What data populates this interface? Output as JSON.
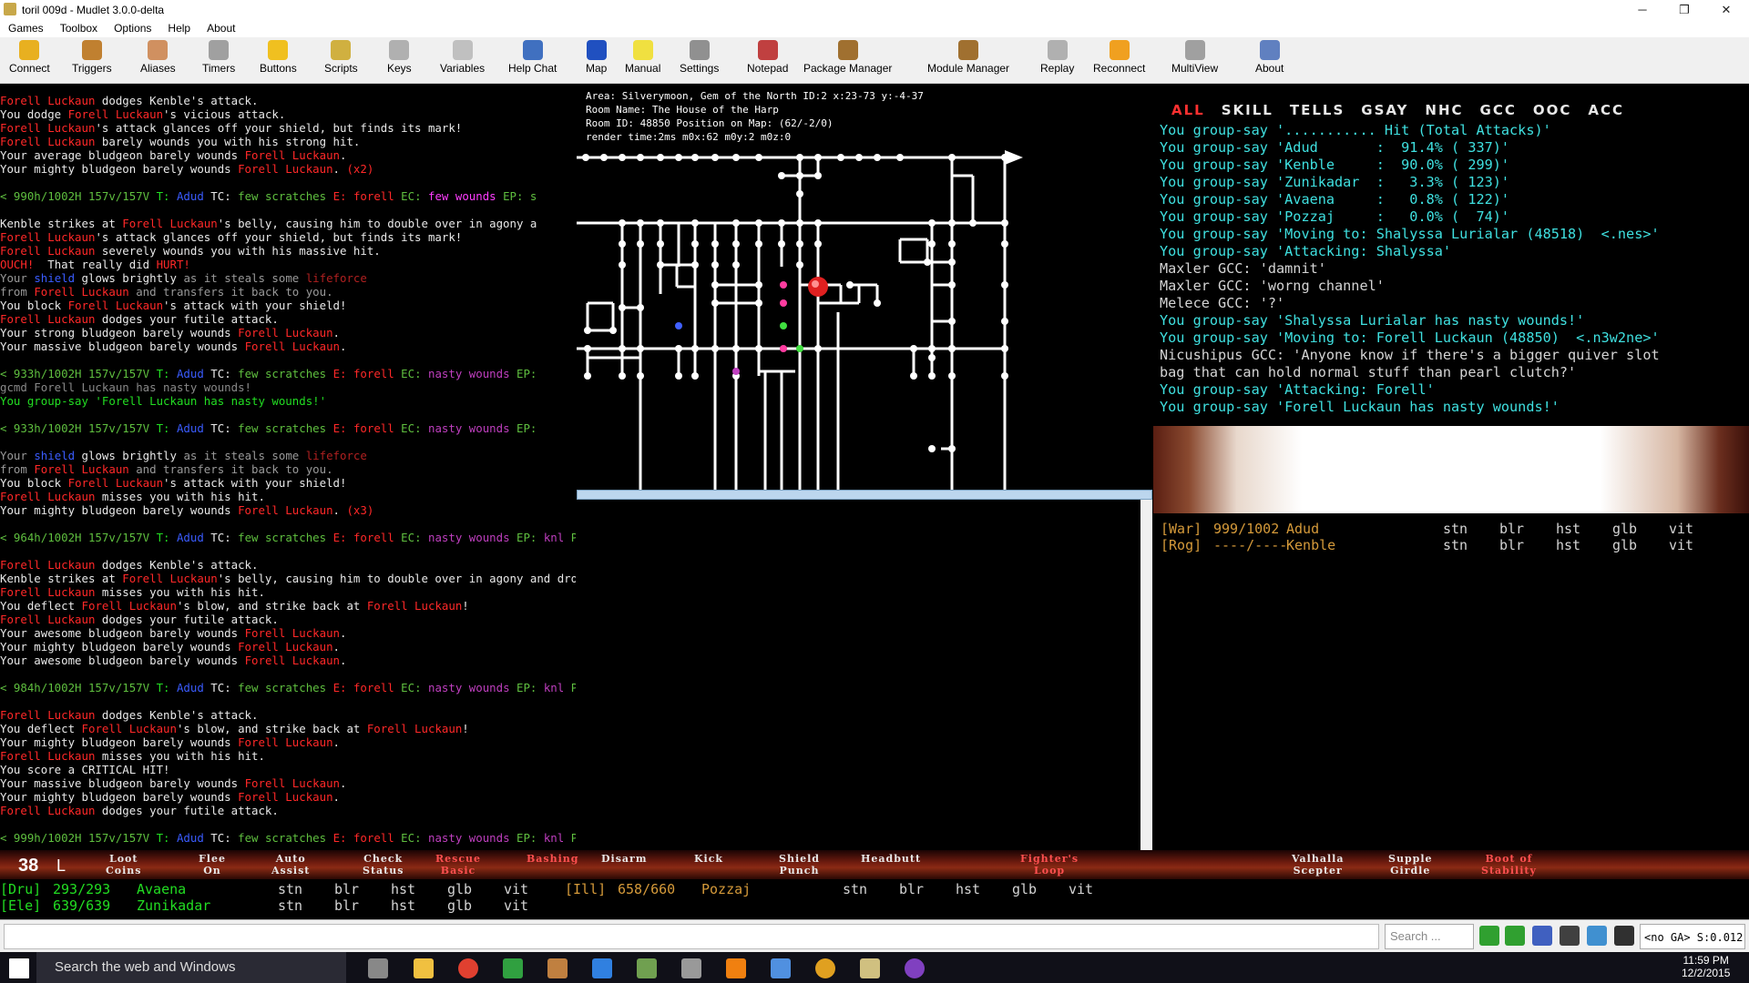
{
  "window": {
    "title": "toril 009d - Mudlet 3.0.0-delta",
    "min": "─",
    "max": "❐",
    "close": "✕"
  },
  "menu": [
    "Games",
    "Toolbox",
    "Options",
    "Help",
    "About"
  ],
  "toolbar": [
    {
      "label": "Connect",
      "icon": "connect-icon",
      "color": "#e8b020"
    },
    {
      "label": "Triggers",
      "icon": "triggers-icon",
      "color": "#c08030"
    },
    {
      "label": "Aliases",
      "icon": "aliases-icon",
      "color": "#d09060"
    },
    {
      "label": "Timers",
      "icon": "timers-icon",
      "color": "#a0a0a0"
    },
    {
      "label": "Buttons",
      "icon": "buttons-icon",
      "color": "#f0c020"
    },
    {
      "label": "Scripts",
      "icon": "scripts-icon",
      "color": "#d0b040"
    },
    {
      "label": "Keys",
      "icon": "keys-icon",
      "color": "#b0b0b0"
    },
    {
      "label": "Variables",
      "icon": "variables-icon",
      "color": "#c0c0c0"
    },
    {
      "label": "Help Chat",
      "icon": "help-chat-icon",
      "color": "#4070c0"
    },
    {
      "label": "Map",
      "icon": "map-icon",
      "color": "#2050c0"
    },
    {
      "label": "Manual",
      "icon": "manual-icon",
      "color": "#f0e040"
    },
    {
      "label": "Settings",
      "icon": "settings-icon",
      "color": "#909090"
    },
    {
      "label": "Notepad",
      "icon": "notepad-icon",
      "color": "#c04040"
    },
    {
      "label": "Package Manager",
      "icon": "package-manager-icon",
      "color": "#a07030"
    },
    {
      "label": "Module Manager",
      "icon": "module-manager-icon",
      "color": "#a07030"
    },
    {
      "label": "Replay",
      "icon": "replay-icon",
      "color": "#b0b0b0"
    },
    {
      "label": "Reconnect",
      "icon": "reconnect-icon",
      "color": "#f0a020"
    },
    {
      "label": "MultiView",
      "icon": "multiview-icon",
      "color": "#a0a0a0"
    },
    {
      "label": "About",
      "icon": "about-icon",
      "color": "#6080c0"
    }
  ],
  "main_output": [
    [
      [
        "r",
        "Forell Luckaun"
      ],
      [
        "w",
        " dodges Kenble's attack."
      ]
    ],
    [
      [
        "w",
        "You dodge "
      ],
      [
        "r",
        "Forell Luckaun"
      ],
      [
        "w",
        "'s vicious attack."
      ]
    ],
    [
      [
        "r",
        "Forell Luckaun"
      ],
      [
        "w",
        "'s attack glances off your shield, but finds its mark!"
      ]
    ],
    [
      [
        "r",
        "Forell Luckaun"
      ],
      [
        "w",
        " barely wounds you with his strong hit."
      ]
    ],
    [
      [
        "w",
        "Your average bludgeon barely wounds "
      ],
      [
        "r",
        "Forell Luckaun"
      ],
      [
        "w",
        "."
      ]
    ],
    [
      [
        "w",
        "Your mighty bludgeon barely wounds "
      ],
      [
        "r",
        "Forell Luckaun"
      ],
      [
        "w",
        ". "
      ],
      [
        "r",
        "(x2)"
      ]
    ],
    [
      [
        "w",
        ""
      ]
    ],
    [
      [
        "g",
        "< 990h/1002H 157v/157V "
      ],
      [
        "lg",
        "T: "
      ],
      [
        "b",
        "Adud "
      ],
      [
        "w",
        "TC: "
      ],
      [
        "g",
        "few scratches "
      ],
      [
        "r",
        "E: forell "
      ],
      [
        "g",
        "EC: "
      ],
      [
        "mb",
        "few wounds "
      ],
      [
        "g",
        "EP: s"
      ]
    ],
    [
      [
        "w",
        ""
      ]
    ],
    [
      [
        "w",
        "Kenble "
      ],
      [
        "w",
        "strikes at "
      ],
      [
        "r",
        "Forell Luckaun"
      ],
      [
        "w",
        "'s belly, causing him to double over in agony a"
      ]
    ],
    [
      [
        "r",
        "Forell Luckaun"
      ],
      [
        "w",
        "'s attack glances off your shield, but finds its mark!"
      ]
    ],
    [
      [
        "r",
        "Forell Luckaun"
      ],
      [
        "w",
        " severely wounds you with his massive hit."
      ]
    ],
    [
      [
        "r",
        "OUCH!"
      ],
      [
        "w",
        "  That really did "
      ],
      [
        "r",
        "HURT!"
      ]
    ],
    [
      [
        "gy",
        "Your "
      ],
      [
        "b",
        "shield"
      ],
      [
        "w",
        " glows brightly "
      ],
      [
        "gy",
        "as it steals some "
      ],
      [
        "dr",
        "lifeforce"
      ]
    ],
    [
      [
        "gy",
        "from "
      ],
      [
        "r",
        "Forell Luckaun"
      ],
      [
        "gy",
        " and transfers it back to you."
      ]
    ],
    [
      [
        "w",
        "You block "
      ],
      [
        "r",
        "Forell Luckaun"
      ],
      [
        "w",
        "'s attack with your shield!"
      ]
    ],
    [
      [
        "r",
        "Forell Luckaun"
      ],
      [
        "w",
        " dodges your futile attack."
      ]
    ],
    [
      [
        "w",
        "Your strong bludgeon barely wounds "
      ],
      [
        "r",
        "Forell Luckaun"
      ],
      [
        "w",
        "."
      ]
    ],
    [
      [
        "w",
        "Your massive bludgeon barely wounds "
      ],
      [
        "r",
        "Forell Luckaun"
      ],
      [
        "w",
        "."
      ]
    ],
    [
      [
        "w",
        ""
      ]
    ],
    [
      [
        "g",
        "< 933h/1002H 157v/157V "
      ],
      [
        "lg",
        "T: "
      ],
      [
        "b",
        "Adud "
      ],
      [
        "w",
        "TC: "
      ],
      [
        "g",
        "few scratches "
      ],
      [
        "r",
        "E: forell "
      ],
      [
        "g",
        "EC: "
      ],
      [
        "m",
        "nasty wounds "
      ],
      [
        "g",
        "EP:"
      ]
    ],
    [
      [
        "dg",
        "gcmd Forell Luckaun has nasty wounds!"
      ]
    ],
    [
      [
        "lg",
        "You group-say 'Forell Luckaun has nasty wounds!'"
      ]
    ],
    [
      [
        "w",
        ""
      ]
    ],
    [
      [
        "g",
        "< 933h/1002H 157v/157V "
      ],
      [
        "lg",
        "T: "
      ],
      [
        "b",
        "Adud "
      ],
      [
        "w",
        "TC: "
      ],
      [
        "g",
        "few scratches "
      ],
      [
        "r",
        "E: forell "
      ],
      [
        "g",
        "EC: "
      ],
      [
        "m",
        "nasty wounds "
      ],
      [
        "g",
        "EP:"
      ]
    ],
    [
      [
        "w",
        ""
      ]
    ],
    [
      [
        "gy",
        "Your "
      ],
      [
        "b",
        "shield"
      ],
      [
        "w",
        " glows brightly "
      ],
      [
        "gy",
        "as it steals some "
      ],
      [
        "dr",
        "lifeforce"
      ]
    ],
    [
      [
        "gy",
        "from "
      ],
      [
        "r",
        "Forell Luckaun"
      ],
      [
        "gy",
        " and transfers it back to you."
      ]
    ],
    [
      [
        "w",
        "You block "
      ],
      [
        "r",
        "Forell Luckaun"
      ],
      [
        "w",
        "'s attack with your shield!"
      ]
    ],
    [
      [
        "r",
        "Forell Luckaun"
      ],
      [
        "w",
        " misses you with his hit."
      ]
    ],
    [
      [
        "w",
        "Your mighty bludgeon barely wounds "
      ],
      [
        "r",
        "Forell Luckaun"
      ],
      [
        "w",
        ". "
      ],
      [
        "r",
        "(x3)"
      ]
    ],
    [
      [
        "w",
        ""
      ]
    ],
    [
      [
        "g",
        "< 964h/1002H 157v/157V "
      ],
      [
        "lg",
        "T: "
      ],
      [
        "b",
        "Adud "
      ],
      [
        "w",
        "TC: "
      ],
      [
        "g",
        "few scratches "
      ],
      [
        "r",
        "E: forell "
      ],
      [
        "g",
        "EC: "
      ],
      [
        "m",
        "nasty wounds "
      ],
      [
        "g",
        "EP: "
      ],
      [
        "m",
        "knl "
      ],
      [
        "g",
        "P: "
      ],
      [
        "w",
        "std >"
      ]
    ],
    [
      [
        "w",
        ""
      ]
    ],
    [
      [
        "r",
        "Forell Luckaun"
      ],
      [
        "w",
        " dodges Kenble's attack."
      ]
    ],
    [
      [
        "w",
        "Kenble strikes at "
      ],
      [
        "r",
        "Forell Luckaun"
      ],
      [
        "w",
        "'s belly, causing him to double over in agony and drop to his knees!"
      ]
    ],
    [
      [
        "r",
        "Forell Luckaun"
      ],
      [
        "w",
        " misses you with his hit."
      ]
    ],
    [
      [
        "w",
        "You deflect "
      ],
      [
        "r",
        "Forell Luckaun"
      ],
      [
        "w",
        "'s blow, and strike back at "
      ],
      [
        "r",
        "Forell Luckaun"
      ],
      [
        "w",
        "!"
      ]
    ],
    [
      [
        "r",
        "Forell Luckaun"
      ],
      [
        "w",
        " dodges your futile attack."
      ]
    ],
    [
      [
        "w",
        "Your awesome bludgeon barely wounds "
      ],
      [
        "r",
        "Forell Luckaun"
      ],
      [
        "w",
        "."
      ]
    ],
    [
      [
        "w",
        "Your mighty bludgeon barely wounds "
      ],
      [
        "r",
        "Forell Luckaun"
      ],
      [
        "w",
        "."
      ]
    ],
    [
      [
        "w",
        "Your awesome bludgeon barely wounds "
      ],
      [
        "r",
        "Forell Luckaun"
      ],
      [
        "w",
        "."
      ]
    ],
    [
      [
        "w",
        ""
      ]
    ],
    [
      [
        "g",
        "< 984h/1002H 157v/157V "
      ],
      [
        "lg",
        "T: "
      ],
      [
        "b",
        "Adud "
      ],
      [
        "w",
        "TC: "
      ],
      [
        "g",
        "few scratches "
      ],
      [
        "r",
        "E: forell "
      ],
      [
        "g",
        "EC: "
      ],
      [
        "m",
        "nasty wounds "
      ],
      [
        "g",
        "EP: "
      ],
      [
        "m",
        "knl "
      ],
      [
        "g",
        "P: "
      ],
      [
        "w",
        "std >"
      ]
    ],
    [
      [
        "w",
        ""
      ]
    ],
    [
      [
        "r",
        "Forell Luckaun"
      ],
      [
        "w",
        " dodges Kenble's attack."
      ]
    ],
    [
      [
        "w",
        "You deflect "
      ],
      [
        "r",
        "Forell Luckaun"
      ],
      [
        "w",
        "'s blow, and strike back at "
      ],
      [
        "r",
        "Forell Luckaun"
      ],
      [
        "w",
        "!"
      ]
    ],
    [
      [
        "w",
        "Your mighty bludgeon barely wounds "
      ],
      [
        "r",
        "Forell Luckaun"
      ],
      [
        "w",
        "."
      ]
    ],
    [
      [
        "r",
        "Forell Luckaun"
      ],
      [
        "w",
        " misses you with his hit."
      ]
    ],
    [
      [
        "w",
        "You score a CRITICAL HIT!"
      ]
    ],
    [
      [
        "w",
        "Your massive bludgeon barely wounds "
      ],
      [
        "r",
        "Forell Luckaun"
      ],
      [
        "w",
        "."
      ]
    ],
    [
      [
        "w",
        "Your mighty bludgeon barely wounds "
      ],
      [
        "r",
        "Forell Luckaun"
      ],
      [
        "w",
        "."
      ]
    ],
    [
      [
        "r",
        "Forell Luckaun"
      ],
      [
        "w",
        " dodges your futile attack."
      ]
    ],
    [
      [
        "w",
        ""
      ]
    ],
    [
      [
        "g",
        "< 999h/1002H 157v/157V "
      ],
      [
        "lg",
        "T: "
      ],
      [
        "b",
        "Adud "
      ],
      [
        "w",
        "TC: "
      ],
      [
        "g",
        "few scratches "
      ],
      [
        "r",
        "E: forell "
      ],
      [
        "g",
        "EC: "
      ],
      [
        "m",
        "nasty wounds "
      ],
      [
        "g",
        "EP: "
      ],
      [
        "m",
        "knl "
      ],
      [
        "g",
        "P: "
      ],
      [
        "w",
        "std >"
      ]
    ]
  ],
  "map_info": [
    "Area: Silverymoon, Gem of the North ID:2 x:23-73 y:-4-37",
    "Room Name: The House of the Harp",
    "Room ID: 48850 Position on Map: (62/-2/0)",
    "render time:2ms m0x:62 m0y:2 m0z:0"
  ],
  "chat_tabs": [
    "ALL",
    "SKILL",
    "TELLS",
    "GSAY",
    "NHC",
    "GCC",
    "OOC",
    "ACC"
  ],
  "chat_lines": [
    [
      [
        "cy",
        "You group-say '........... Hit (Total Attacks)'"
      ]
    ],
    [
      [
        "cy",
        "You group-say 'Adud       :  91.4% ( 337)'"
      ]
    ],
    [
      [
        "cy",
        "You group-say 'Kenble     :  90.0% ( 299)'"
      ]
    ],
    [
      [
        "cy",
        "You group-say 'Zunikadar  :   3.3% ( 123)'"
      ]
    ],
    [
      [
        "cy",
        "You group-say 'Avaena     :   0.8% ( 122)'"
      ]
    ],
    [
      [
        "cy",
        "You group-say 'Pozzaj     :   0.0% (  74)'"
      ]
    ],
    [
      [
        "cy",
        "You group-say 'Moving to: Shalyssa Lurialar (48518)  <.nes>'"
      ]
    ],
    [
      [
        "cy",
        "You group-say 'Attacking: Shalyssa'"
      ]
    ],
    [
      [
        "gr",
        "Maxler GCC: 'damnit'"
      ]
    ],
    [
      [
        "gr",
        "Maxler GCC: 'worng channel'"
      ]
    ],
    [
      [
        "gr",
        "Melece GCC: '?'"
      ]
    ],
    [
      [
        "cy",
        "You group-say 'Shalyssa Lurialar has nasty wounds!'"
      ]
    ],
    [
      [
        "cy",
        "You group-say 'Moving to: Forell Luckaun (48850)  <.n3w2ne>'"
      ]
    ],
    [
      [
        "gr",
        "Nicushipus GCC: 'Anyone know if there's a bigger quiver slot"
      ]
    ],
    [
      [
        "gr",
        "bag that can hold normal stuff than pearl clutch?'"
      ]
    ],
    [
      [
        "cy",
        "You group-say 'Attacking: Forell'"
      ]
    ],
    [
      [
        "cy",
        "You group-say 'Forell Luckaun has nasty wounds!'"
      ]
    ]
  ],
  "group_top": [
    {
      "cls": "[War]",
      "hp": "999/1002",
      "name": "Adud",
      "cols": [
        "stn",
        "blr",
        "hst",
        "glb",
        "vit"
      ]
    },
    {
      "cls": "[Rog]",
      "hp": "----/----",
      "name": "Kenble",
      "cols": [
        "stn",
        "blr",
        "hst",
        "glb",
        "vit"
      ]
    }
  ],
  "level": "38",
  "level_suffix": "L",
  "buttons": [
    [
      "Loot",
      "Coins"
    ],
    [
      "Flee",
      "On"
    ],
    [
      "Auto",
      "Assist"
    ],
    [
      "Check",
      "Status"
    ],
    [
      "Rescue",
      "Basic"
    ],
    [
      "Bashing",
      ""
    ],
    [
      "Disarm",
      ""
    ],
    [
      "Kick",
      ""
    ],
    [
      "Shield",
      "Punch"
    ],
    [
      "Headbutt",
      ""
    ],
    [
      "Fighter's",
      "Loop"
    ],
    [
      "Valhalla",
      "Scepter"
    ],
    [
      "Supple",
      "Girdle"
    ],
    [
      "Boot of",
      "Stability"
    ]
  ],
  "party_bottom": [
    {
      "cls": "[Dru]",
      "hp": "293/293",
      "name": "Avaena",
      "cols": [
        "stn",
        "blr",
        "hst",
        "glb",
        "vit"
      ]
    },
    {
      "cls": "[Ele]",
      "hp": "639/639",
      "name": "Zunikadar",
      "cols": [
        "stn",
        "blr",
        "hst",
        "glb",
        "vit"
      ]
    },
    {
      "cls": "[Ill]",
      "hp": "658/660",
      "name": "Pozzaj",
      "cols": [
        "stn",
        "blr",
        "hst",
        "glb",
        "vit"
      ]
    }
  ],
  "cmd": {
    "search_placeholder": "Search ...",
    "ga": "<no GA> S:0.012"
  },
  "taskbar": {
    "search": "Search the web and Windows",
    "time": "11:59 PM",
    "date": "12/2/2015"
  }
}
